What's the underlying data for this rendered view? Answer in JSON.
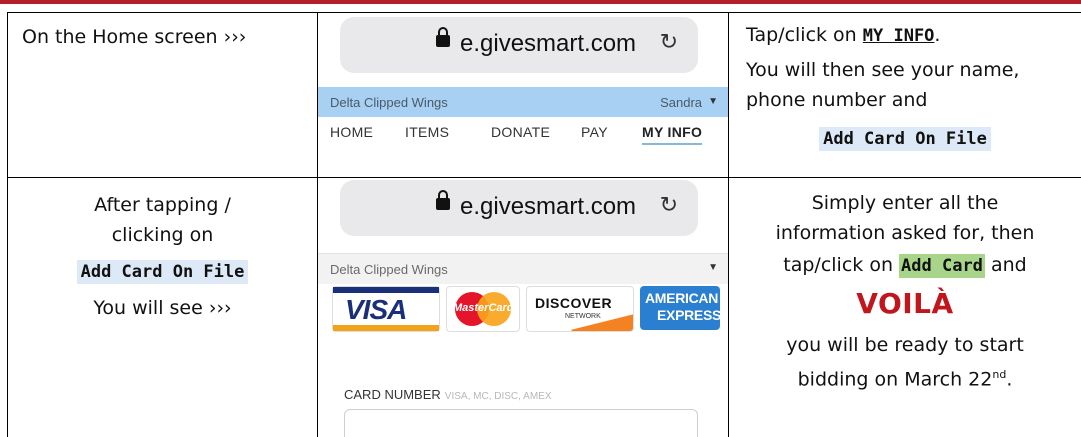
{
  "row1": {
    "left": {
      "text": "On the Home screen ›››"
    },
    "screenshot": {
      "url": "e.givesmart.com",
      "reload_icon": "reload-icon",
      "org_name": "Delta Clipped Wings",
      "user_name": "Sandra",
      "nav": [
        "HOME",
        "ITEMS",
        "DONATE",
        "PAY",
        "MY INFO"
      ],
      "active_nav": "MY INFO",
      "active_color": "#89b7d6"
    },
    "right": {
      "line1_prefix": "Tap/click on ",
      "line1_link": "MY INFO",
      "line1_suffix": ".",
      "line2": "You will then see your name,",
      "line3": "phone number and",
      "button_text": "Add Card On File"
    }
  },
  "row2": {
    "left": {
      "line1": "After tapping /",
      "line2": "clicking on",
      "button_text": "Add Card On File",
      "line4": "You will see ›››"
    },
    "screenshot": {
      "url": "e.givesmart.com",
      "org_name": "Delta Clipped Wings",
      "cards": {
        "visa": "VISA",
        "mastercard": "MasterCard",
        "discover": "DISCOVER",
        "discover_sub": "NETWORK",
        "amex_1": "AMERICAN",
        "amex_2": "EXPRESS"
      },
      "card_number_label": "CARD NUMBER",
      "card_number_hint": "VISA, MC, DISC, AMEX"
    },
    "right": {
      "line1": "Simply enter all the",
      "line2": "information asked for, then",
      "line3_prefix": "tap/click on ",
      "line3_button": "Add Card",
      "line3_suffix": " and",
      "voila": "VOILÀ",
      "line5": "you will be ready to start",
      "line6_prefix": "bidding on March 22",
      "line6_sup": "nd",
      "line6_suffix": "."
    }
  },
  "colors": {
    "accent_red": "#b21e2a",
    "highlight_blue": "#dde9f7",
    "highlight_green": "#a9d58a",
    "voila_red": "#c0161c"
  }
}
